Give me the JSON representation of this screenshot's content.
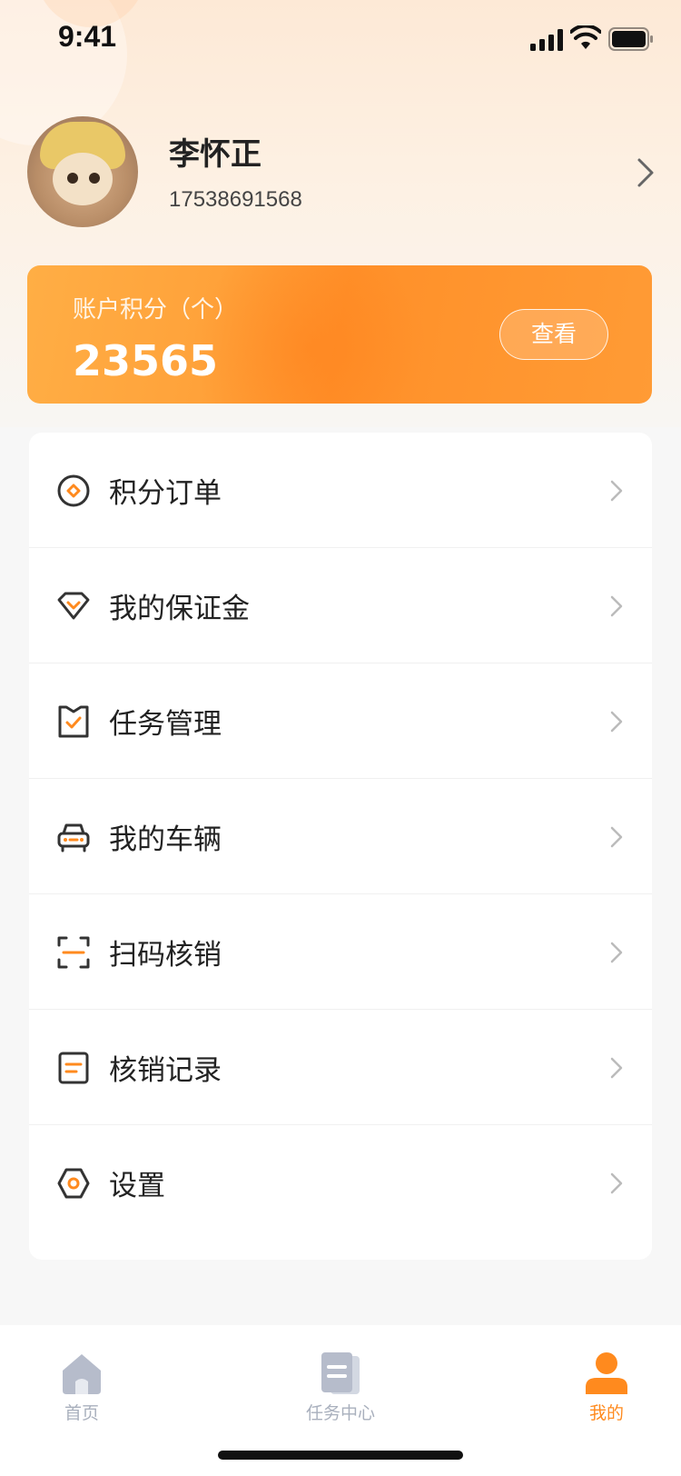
{
  "status_bar": {
    "time": "9:41"
  },
  "profile": {
    "name": "李怀正",
    "phone": "17538691568"
  },
  "points": {
    "label": "账户积分（个）",
    "value": "23565",
    "button_label": "查看"
  },
  "menu": {
    "items": [
      {
        "label": "积分订单",
        "icon": "points-order-icon"
      },
      {
        "label": "我的保证金",
        "icon": "deposit-icon"
      },
      {
        "label": "任务管理",
        "icon": "task-manage-icon"
      },
      {
        "label": "我的车辆",
        "icon": "car-icon"
      },
      {
        "label": "扫码核销",
        "icon": "scan-icon"
      },
      {
        "label": "核销记录",
        "icon": "record-icon"
      },
      {
        "label": "设置",
        "icon": "settings-icon"
      }
    ]
  },
  "tab_bar": {
    "tabs": [
      {
        "label": "首页",
        "icon": "home-icon",
        "active": false
      },
      {
        "label": "任务中心",
        "icon": "task-center-icon",
        "active": false
      },
      {
        "label": "我的",
        "icon": "profile-icon",
        "active": true
      }
    ]
  },
  "colors": {
    "accent": "#ff8a1e",
    "icon_dark": "#333333",
    "tab_inactive": "#a9b0bd"
  }
}
